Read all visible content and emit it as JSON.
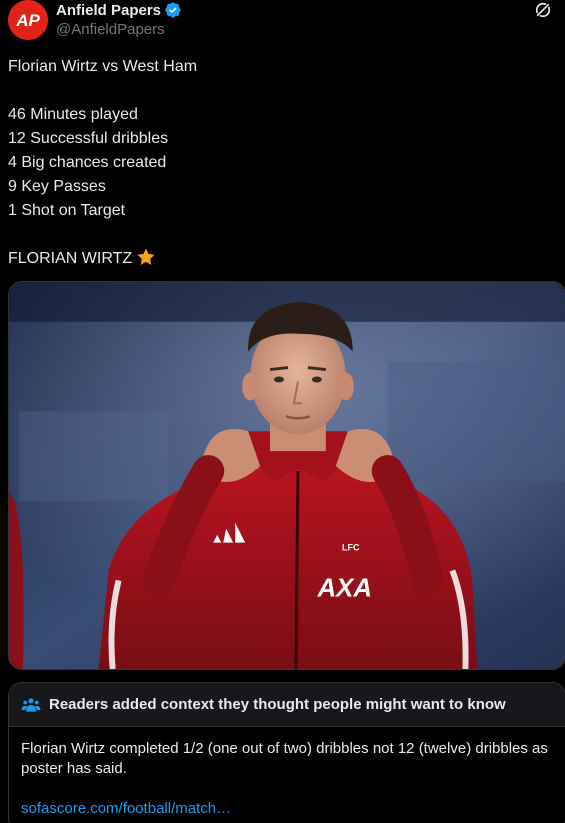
{
  "author": {
    "display_name": "Anfield Papers",
    "handle": "@AnfieldPapers",
    "avatar_text": "AP",
    "verified": true
  },
  "tweet": {
    "title_line": "Florian Wirtz vs West Ham",
    "stats": [
      "46 Minutes played",
      "12 Successful dribbles",
      "4 Big chances created",
      "9 Key Passes",
      "1 Shot on Target"
    ],
    "closing_line": "FLORIAN WIRTZ",
    "closing_emoji": "star-emoji"
  },
  "media": {
    "image_alt": "photo",
    "jacket_sponsor_text": "AXA",
    "jacket_badge_text": "LFC"
  },
  "community_note": {
    "title": "Readers added context they thought people might want to know",
    "body": "Florian Wirtz completed 1/2 (one out of two) dribbles not 12 (twelve) dribbles as poster has said.",
    "link": "sofascore.com/football/match…"
  },
  "colors": {
    "background": "#000000",
    "text": "#e7e9ea",
    "muted": "#71767b",
    "link": "#1d9bf0",
    "verified": "#1d9bf0",
    "avatar": "#e2231a",
    "jacket": "#a3121c",
    "star": "#f4a51c"
  }
}
